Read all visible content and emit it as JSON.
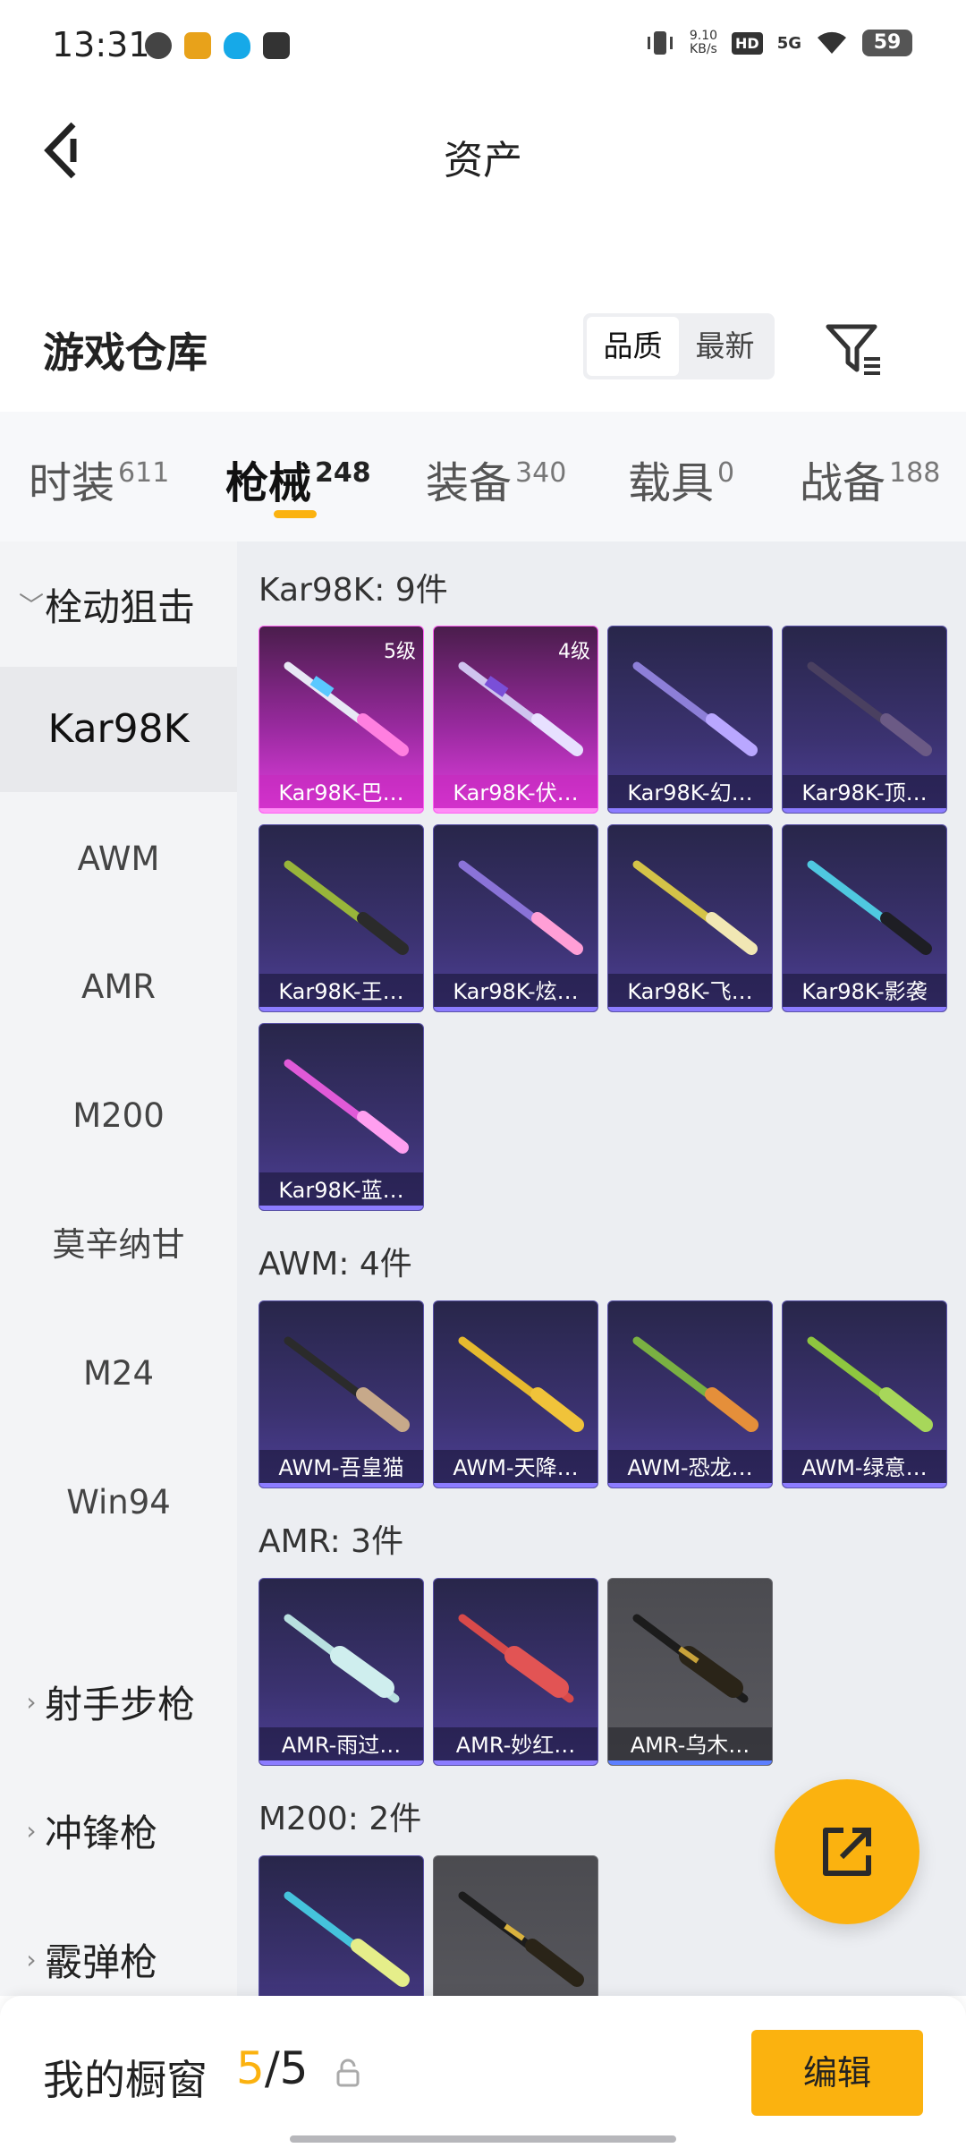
{
  "status_bar": {
    "time": "13:31",
    "net_speed_value": "9.10",
    "net_speed_unit": "KB/s",
    "hd": "HD",
    "signal": "5G",
    "battery": "59"
  },
  "header": {
    "title": "资产",
    "back_icon": "chevron-left-icon"
  },
  "warehouse": {
    "title": "游戏仓库",
    "sort_options": [
      "品质",
      "最新"
    ],
    "active_sort": "品质",
    "filter_icon": "filter-icon"
  },
  "category_tabs": [
    {
      "label": "时装",
      "count": "611",
      "active": false
    },
    {
      "label": "枪械",
      "count": "248",
      "active": true
    },
    {
      "label": "装备",
      "count": "340",
      "active": false
    },
    {
      "label": "载具",
      "count": "0",
      "active": false
    },
    {
      "label": "战备",
      "count": "188",
      "active": false
    }
  ],
  "sidebar": {
    "group_open": "栓动狙击",
    "items": [
      "Kar98K",
      "AWM",
      "AMR",
      "M200",
      "莫辛纳甘",
      "M24",
      "Win94"
    ],
    "active_item": "Kar98K",
    "groups_closed": [
      "射手步枪",
      "冲锋枪",
      "霰弹枪"
    ]
  },
  "sections": [
    {
      "title": "Kar98K: 9件",
      "items": [
        {
          "label": "Kar98K-巴…",
          "level": "5级",
          "rarity": "pink"
        },
        {
          "label": "Kar98K-伏…",
          "level": "4级",
          "rarity": "pink"
        },
        {
          "label": "Kar98K-幻…",
          "level": "",
          "rarity": "purple"
        },
        {
          "label": "Kar98K-顶…",
          "level": "",
          "rarity": "purple"
        },
        {
          "label": "Kar98K-王…",
          "level": "",
          "rarity": "purple"
        },
        {
          "label": "Kar98K-炫…",
          "level": "",
          "rarity": "purple"
        },
        {
          "label": "Kar98K-飞…",
          "level": "",
          "rarity": "purple"
        },
        {
          "label": "Kar98K-影袭",
          "level": "",
          "rarity": "purple"
        },
        {
          "label": "Kar98K-蓝…",
          "level": "",
          "rarity": "purple"
        }
      ]
    },
    {
      "title": "AWM: 4件",
      "items": [
        {
          "label": "AWM-吾皇猫",
          "level": "",
          "rarity": "purple"
        },
        {
          "label": "AWM-天降…",
          "level": "",
          "rarity": "purple"
        },
        {
          "label": "AWM-恐龙…",
          "level": "",
          "rarity": "purple"
        },
        {
          "label": "AWM-绿意…",
          "level": "",
          "rarity": "purple"
        }
      ]
    },
    {
      "title": "AMR: 3件",
      "items": [
        {
          "label": "AMR-雨过…",
          "level": "",
          "rarity": "purple"
        },
        {
          "label": "AMR-妙红…",
          "level": "",
          "rarity": "purple"
        },
        {
          "label": "AMR-乌木…",
          "level": "",
          "rarity": "grey"
        }
      ]
    },
    {
      "title": "M200: 2件",
      "items": [
        {
          "label": "",
          "level": "",
          "rarity": "purple"
        },
        {
          "label": "",
          "level": "",
          "rarity": "grey"
        }
      ]
    }
  ],
  "fab": {
    "icon": "share-out-icon"
  },
  "bottom_bar": {
    "label": "我的橱窗",
    "count_current": "5",
    "count_sep_total": "/5",
    "lock_icon": "lock-icon",
    "edit_label": "编辑"
  },
  "colors": {
    "accent": "#fbb20f",
    "card_purple": "#3b3270",
    "card_pink": "#e23ee0",
    "card_grey": "#5a5a60"
  }
}
